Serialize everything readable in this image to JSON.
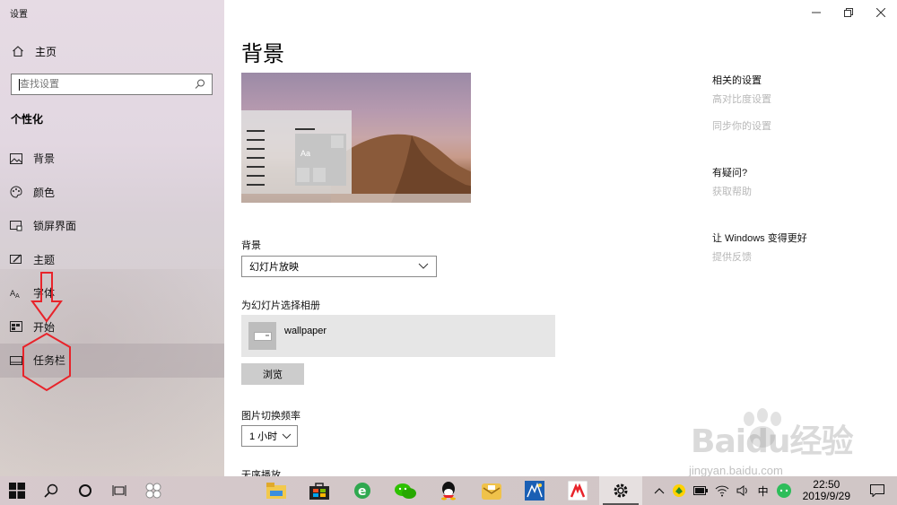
{
  "window": {
    "title": "设置"
  },
  "sidebar": {
    "home_label": "主页",
    "search_placeholder": "查找设置",
    "section_title": "个性化",
    "items": [
      {
        "label": "背景",
        "icon": "picture-icon"
      },
      {
        "label": "颜色",
        "icon": "palette-icon"
      },
      {
        "label": "锁屏界面",
        "icon": "lock-screen-icon"
      },
      {
        "label": "主题",
        "icon": "theme-icon"
      },
      {
        "label": "字体",
        "icon": "font-icon"
      },
      {
        "label": "开始",
        "icon": "start-icon"
      },
      {
        "label": "任务栏",
        "icon": "taskbar-icon"
      }
    ],
    "active_item": "任务栏"
  },
  "main": {
    "page_title": "背景",
    "preview_tile_text": "Aa",
    "background_label": "背景",
    "background_value": "幻灯片放映",
    "album_label": "为幻灯片选择相册",
    "album_name": "wallpaper",
    "browse_label": "浏览",
    "frequency_label": "图片切换频率",
    "frequency_value": "1 小时",
    "shuffle_label": "无序播放"
  },
  "related": {
    "heading": "相关的设置",
    "links": [
      "高对比度设置",
      "同步你的设置"
    ],
    "question_heading": "有疑问?",
    "help_link": "获取帮助",
    "improve_heading": "让 Windows 变得更好",
    "feedback_link": "提供反馈"
  },
  "watermark": {
    "brand": "Baidu经验",
    "url": "jingyan.baidu.com"
  },
  "taskbar": {
    "apps": [
      "file-explorer-icon",
      "store-icon",
      "ie-browser-icon",
      "wechat-icon",
      "qq-icon",
      "mail-app-icon",
      "game-app-icon",
      "red-app-icon",
      "settings-gear-icon"
    ],
    "ime_label": "中",
    "time": "22:50",
    "date": "2019/9/29"
  },
  "colors": {
    "sidebar_bg": "#e2d7e1",
    "annotation": "#e8232a",
    "link_gray": "#b8b8b8"
  }
}
